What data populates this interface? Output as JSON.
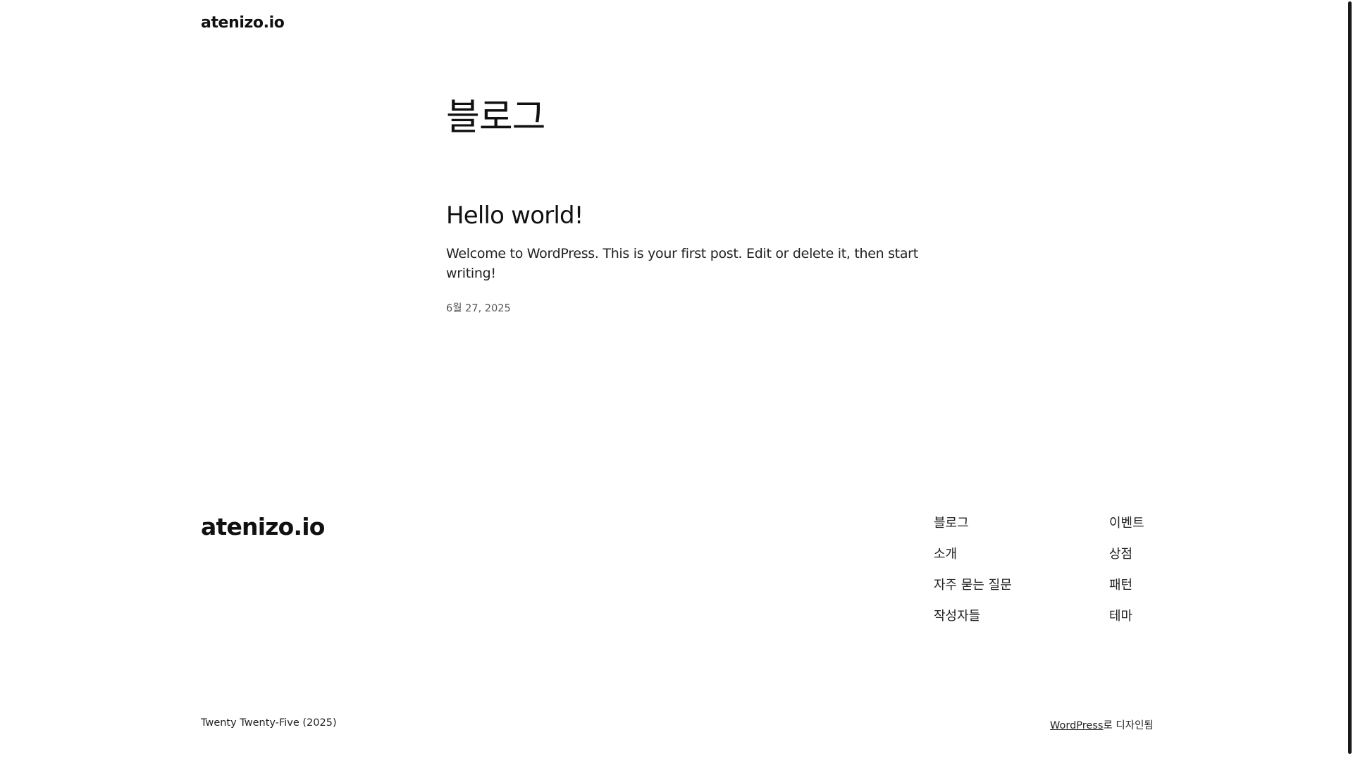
{
  "header": {
    "site_title": "atenizo.io"
  },
  "main": {
    "page_heading": "블로그",
    "post": {
      "title": "Hello world!",
      "excerpt": "Welcome to WordPress. This is your first post. Edit or delete it, then start writing!",
      "date": "6월 27, 2025"
    }
  },
  "footer": {
    "site_title": "atenizo.io",
    "nav_column_1": [
      "블로그",
      "소개",
      "자주 묻는 질문",
      "작성자들"
    ],
    "nav_column_2": [
      "이벤트",
      "상점",
      "패턴",
      "테마"
    ],
    "theme_credit": "Twenty Twenty-Five (2025)",
    "designed_with": {
      "link": "WordPress",
      "suffix": "로 디자인됨"
    }
  }
}
